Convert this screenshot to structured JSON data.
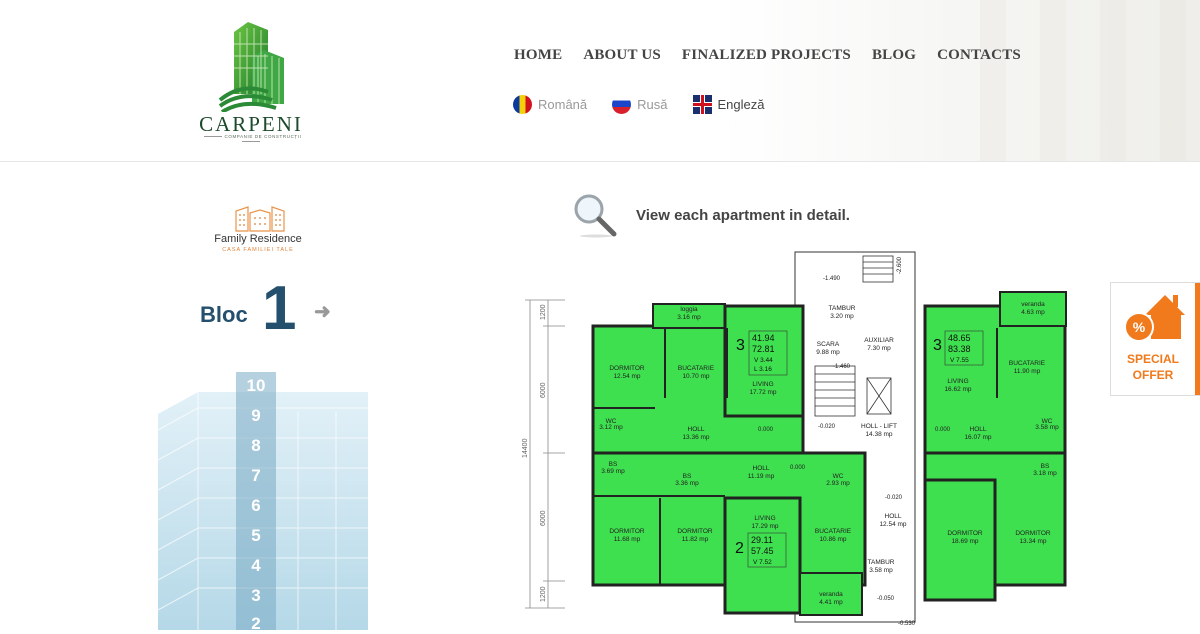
{
  "brand": {
    "name": "CARPENI",
    "tagline": "COMPANIE DE CONSTRUCȚII",
    "colors": {
      "green": "#2f9a3a",
      "dark_green": "#1d4a2a",
      "plan_green": "#33e04a",
      "accent_orange": "#f07a1c",
      "bloc_blue": "#24506e"
    }
  },
  "nav": {
    "items": [
      {
        "label": "HOME"
      },
      {
        "label": "ABOUT US"
      },
      {
        "label": "FINALIZED PROJECTS"
      },
      {
        "label": "BLOG"
      },
      {
        "label": "CONTACTS"
      }
    ]
  },
  "languages": [
    {
      "label": "Română",
      "flag": "romania-flag-icon",
      "active": false
    },
    {
      "label": "Rusă",
      "flag": "russia-flag-icon",
      "active": false
    },
    {
      "label": "Engleză",
      "flag": "uk-flag-icon",
      "active": true
    }
  ],
  "project": {
    "title": "Family Residence",
    "subtitle": "CASA FAMILIEI TALE",
    "bloc_label": "Bloc",
    "bloc_number": "1",
    "next_icon": "arrow-right-icon",
    "floors": [
      "10",
      "9",
      "8",
      "7",
      "6",
      "5",
      "4",
      "3",
      "2"
    ]
  },
  "hint": {
    "icon": "magnifier-icon",
    "text": "View each apartment in detail."
  },
  "special_offer": {
    "line1": "SPECIAL",
    "line2": "OFFER",
    "icon": "house-percent-icon"
  },
  "floor_plan": {
    "dimensions": {
      "total": "14400",
      "segments": [
        "1200",
        "6000",
        "6000",
        "1200"
      ]
    },
    "apartments": [
      {
        "rooms": "3",
        "areas": [
          "41.94",
          "72.81"
        ],
        "v": "V 3.44",
        "l": "L 3.16"
      },
      {
        "rooms": "3",
        "areas": [
          "48.65",
          "83.38"
        ],
        "v": "V 7.55"
      },
      {
        "rooms": "2",
        "areas": [
          "29.11",
          "57.45"
        ],
        "v": "V 7.52"
      }
    ],
    "rooms": [
      {
        "name": "loggia",
        "area": "3.16 mp"
      },
      {
        "name": "DORMITOR",
        "area": "12.54 mp"
      },
      {
        "name": "BUCATARIE",
        "area": "10.70 mp"
      },
      {
        "name": "LIVING",
        "area": "17.72 mp"
      },
      {
        "name": "WC",
        "area": "3.12 mp"
      },
      {
        "name": "HOLL",
        "area": "13.36 mp"
      },
      {
        "name": "BS",
        "area": "3.69 mp"
      },
      {
        "name": "DORMITOR",
        "area": "11.68 mp"
      },
      {
        "name": "BS",
        "area": "3.36 mp"
      },
      {
        "name": "HOLL",
        "area": "11.19 mp"
      },
      {
        "name": "WC",
        "area": "2.93 mp"
      },
      {
        "name": "DORMITOR",
        "area": "11.82 mp"
      },
      {
        "name": "LIVING",
        "area": "17.29 mp"
      },
      {
        "name": "BUCATARIE",
        "area": "10.86 mp"
      },
      {
        "name": "veranda",
        "area": "4.41 mp"
      },
      {
        "name": "TAMBUR",
        "area": "3.20 mp"
      },
      {
        "name": "SCARA",
        "area": "9.88 mp"
      },
      {
        "name": "AUXILIAR",
        "area": "7.30 mp"
      },
      {
        "name": "HOLL - LIFT",
        "area": "14.38 mp"
      },
      {
        "name": "HOLL",
        "area": "12.54 mp"
      },
      {
        "name": "TAMBUR",
        "area": "3.58 mp"
      },
      {
        "name": "veranda",
        "area": "4.63 mp"
      },
      {
        "name": "LIVING",
        "area": "16.62 mp"
      },
      {
        "name": "BUCATARIE",
        "area": "11.90 mp"
      },
      {
        "name": "HOLL",
        "area": "16.07 mp"
      },
      {
        "name": "WC",
        "area": "3.58 mp"
      },
      {
        "name": "BS",
        "area": "3.18 mp"
      },
      {
        "name": "DORMITOR",
        "area": "18.69 mp"
      },
      {
        "name": "DORMITOR",
        "area": "13.34 mp"
      }
    ],
    "levels": [
      "-1.490",
      "-2.600",
      "-1.460",
      "-0.020",
      "0.000",
      "0.000",
      "0.000",
      "-0.020",
      "-0.050",
      "-0.530"
    ]
  }
}
